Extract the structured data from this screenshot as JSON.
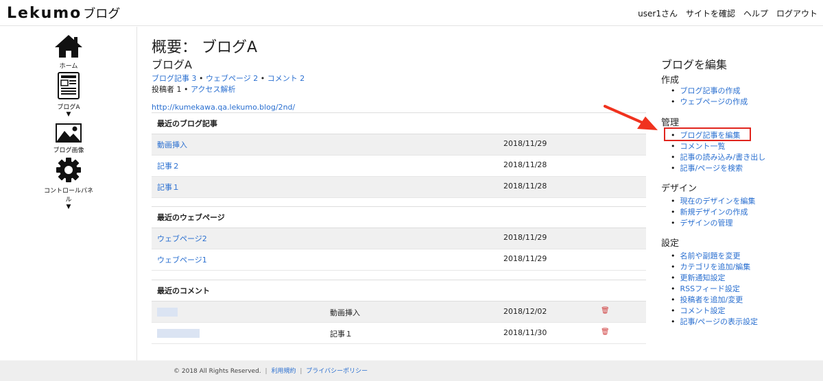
{
  "header": {
    "logo": "Lekumo",
    "logo_sub": "ブログ",
    "nav": [
      "user1さん",
      "サイトを確認",
      "ヘルプ",
      "ログアウト"
    ]
  },
  "sidebar": {
    "items": [
      {
        "label": "ホーム",
        "icon": "home-icon"
      },
      {
        "label": "ブログA",
        "icon": "blog-document-icon",
        "caret": "▼"
      },
      {
        "label": "ブログ画像",
        "icon": "image-icon"
      },
      {
        "label": "コントロールパネル",
        "icon": "gear-icon",
        "caret": "▼"
      }
    ]
  },
  "main": {
    "title": "概要： ブログA",
    "blog_name": "ブログA",
    "stats": {
      "posts": "ブログ記事 3",
      "pages": "ウェブページ 2",
      "comments": "コメント 2",
      "authors": "投稿者 1",
      "access": "アクセス解析",
      "sep": "•"
    },
    "url": "http://kumekawa.qa.lekumo.blog/2nd/",
    "recent_posts": {
      "heading": "最近のブログ記事",
      "rows": [
        {
          "title": "動画挿入",
          "date": "2018/11/29"
        },
        {
          "title": "記事２",
          "date": "2018/11/28"
        },
        {
          "title": "記事１",
          "date": "2018/11/28"
        }
      ]
    },
    "recent_pages": {
      "heading": "最近のウェブページ",
      "rows": [
        {
          "title": "ウェブページ2",
          "date": "2018/11/29"
        },
        {
          "title": "ウェブページ1",
          "date": "2018/11/29"
        }
      ]
    },
    "recent_comments": {
      "heading": "最近のコメント",
      "rows": [
        {
          "entry": "動画挿入",
          "date": "2018/12/02"
        },
        {
          "entry": "記事１",
          "date": "2018/11/30"
        }
      ]
    }
  },
  "right": {
    "title": "ブログを編集",
    "sections": [
      {
        "heading": "作成",
        "links": [
          "ブログ記事の作成",
          "ウェブページの作成"
        ]
      },
      {
        "heading": "管理",
        "links": [
          "ブログ記事を編集",
          "コメント一覧",
          "記事の読み込み/書き出し",
          "記事/ページを検索"
        ]
      },
      {
        "heading": "デザイン",
        "links": [
          "現在のデザインを編集",
          "新規デザインの作成",
          "デザインの管理"
        ]
      },
      {
        "heading": "設定",
        "links": [
          "名前や副題を変更",
          "カテゴリを追加/編集",
          "更新通知設定",
          "RSSフィード設定",
          "投稿者を追加/変更",
          "コメント設定",
          "記事/ページの表示設定"
        ]
      }
    ],
    "highlight_color": "#e0241d"
  },
  "footer": {
    "copyright": "© 2018 All Rights Reserved.",
    "terms": "利用規約",
    "privacy": "プライバシーポリシー",
    "sep": "|"
  }
}
